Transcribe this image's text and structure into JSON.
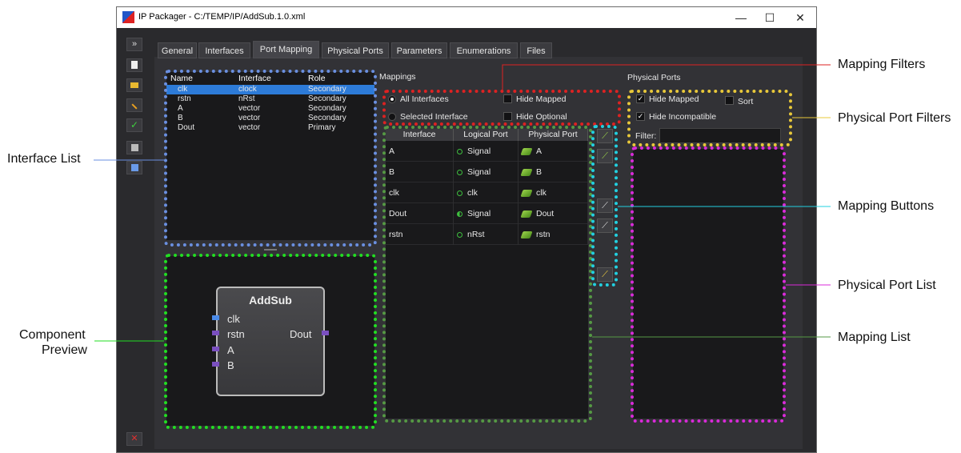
{
  "window": {
    "title": "IP Packager - C:/TEMP/IP/AddSub.1.0.xml",
    "minimize": "—",
    "maximize": "☐",
    "close": "✕"
  },
  "toolbar": {
    "expand_icon": "»"
  },
  "tabs": [
    "General",
    "Interfaces",
    "Port Mapping",
    "Physical Ports",
    "Parameters",
    "Enumerations",
    "Files"
  ],
  "interface_list": {
    "columns": [
      "Name",
      "Interface",
      "Role"
    ],
    "rows": [
      [
        "clk",
        "clock",
        "Secondary"
      ],
      [
        "rstn",
        "nRst",
        "Secondary"
      ],
      [
        "A",
        "vector",
        "Secondary"
      ],
      [
        "B",
        "vector",
        "Secondary"
      ],
      [
        "Dout",
        "vector",
        "Primary"
      ]
    ]
  },
  "component": {
    "name": "AddSub",
    "inputs": [
      "clk",
      "rstn",
      "A",
      "B"
    ],
    "output": "Dout"
  },
  "mappings": {
    "title": "Mappings",
    "all_interfaces": "All Interfaces",
    "selected_interface": "Selected Interface",
    "hide_mapped": "Hide Mapped",
    "hide_optional": "Hide Optional",
    "columns": [
      "Interface",
      "Logical Port",
      "Physical Port"
    ],
    "rows": [
      [
        "A",
        "Signal",
        "A"
      ],
      [
        "B",
        "Signal",
        "B"
      ],
      [
        "clk",
        "clk",
        "clk"
      ],
      [
        "Dout",
        "Signal",
        "Dout"
      ],
      [
        "rstn",
        "nRst",
        "rstn"
      ]
    ]
  },
  "physical_ports": {
    "title": "Physical Ports",
    "hide_mapped": "Hide Mapped",
    "sort": "Sort",
    "hide_incompatible": "Hide Incompatible",
    "filter_label": "Filter:"
  },
  "annotations": {
    "mapping_filters": "Mapping Filters",
    "physical_port_filters": "Physical Port Filters",
    "interface_list": "Interface List",
    "mapping_buttons": "Mapping Buttons",
    "physical_port_list": "Physical Port List",
    "component_preview_1": "Component",
    "component_preview_2": "Preview",
    "mapping_list": "Mapping List"
  },
  "colors": {
    "interface_list_highlight": "#6a8fe0",
    "component_preview_highlight": "#22dd22",
    "mapping_filters_highlight": "#dd2222",
    "mapping_list_highlight": "#559944",
    "mapping_buttons_highlight": "#22d0e0",
    "physical_port_filters_highlight": "#e8c83a",
    "physical_port_list_highlight": "#d92ad9",
    "selection": "#2d7bd8"
  }
}
